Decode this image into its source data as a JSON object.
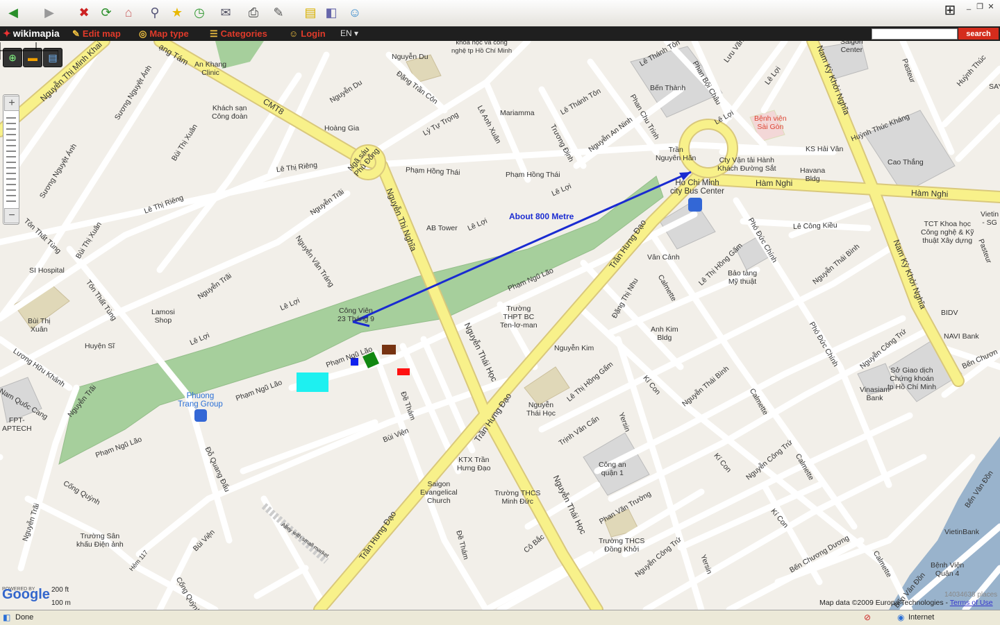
{
  "browser": {
    "toolbar_icons": [
      "back-icon",
      "forward-icon",
      "stop-icon",
      "refresh-icon",
      "home-icon",
      "search-icon",
      "favorites-icon",
      "history-icon",
      "mail-icon",
      "print-icon",
      "edit-icon",
      "discuss-icon",
      "research-icon",
      "messenger-icon"
    ],
    "status": "Done",
    "zone": "Internet"
  },
  "wikimapia": {
    "logo": "wikimapia",
    "menu": [
      "Edit map",
      "Map type",
      "Categories",
      "Login"
    ],
    "lang": "EN",
    "search_placeholder": "",
    "search_button": "search"
  },
  "map": {
    "annotation": "About 800 Metre",
    "scale_ft": "200 ft",
    "scale_m": "100 m",
    "google": "Google",
    "powered_by": "POWERED BY",
    "attribution": "Map data ©2009 Europa Technologies -",
    "terms": "Terms of Use",
    "places_count": "14034638 places",
    "places": {
      "an_khang": "An Khang\nClinic",
      "khach_san": "Khách sạn\nCông đoàn",
      "hoang_gia": "Hoàng Gia",
      "nguyen_du_place": "Nguyễn Du",
      "trung_tam": "Trung tâm thông tin\nkhoa học và công\nnghệ tp Hồ Chí Minh",
      "mariamma": "Mariamma",
      "ben_thanh": "Bến Thành",
      "tran_nguyen_han": "Trần\nNguyên Hãn",
      "benh_vien_sg": "Bệnh viện\nSài Gòn",
      "cty_van_tai": "Cty Vận tải Hành\nKhách Đường Sắt",
      "havana": "Havana\nBldg",
      "cao_thang": "Cao Thắng",
      "saigon_center": "Saigon\nCenter",
      "bus_center": "Ho Chi Minh\ncity Bus Center",
      "ab_tower": "AB Tower",
      "cong_vien": "Công Viên\n23 Tháng 9",
      "si_hospital": "SI Hospital",
      "bui_thi_xuan_place": "Bùi Thị\nXuân",
      "lamosi": "Lamosi\nShop",
      "huyen_si": "Huyện Sĩ",
      "phuong_trang": "Phuong\nTrang Group",
      "truong_thpt": "Trường\nTHPT BC\nTen-lơ-man",
      "van_canh": "Vân Cảnh",
      "bao_tang": "Bảo tàng\nMỹ thuật",
      "anh_kim": "Anh Kim\nBldg",
      "nguyen_kim": "Nguyễn Kim",
      "nguyen_thai_hoc_place": "Nguyễn\nThái Học",
      "cong_an": "Công an\nquận 1",
      "ktx": "KTX Trần\nHưng Đạo",
      "saigon_church": "Saigon\nEvangelical\nChurch",
      "thcs_minh_duc": "Trường THCS\nMinh Đức",
      "thcs_dong_khoi": "Trường THCS\nĐồng Khởi",
      "truong_san_khau": "Trường Sân\nkhấu Điện ảnh",
      "fpt": "FPT-\nAPTECH",
      "bidv": "BIDV",
      "navi": "NAVI Bank",
      "so_giao_dich": "Sở Giao dịch\nChứng khoán\ntp Hồ Chí Minh",
      "vinasiam": "Vinasiam\nBank",
      "vietinbank": "VietinBank",
      "benh_vien_q4": "Bệnh Viện\nQuận 4",
      "tct_khoa_hoc": "TCT Khoa học\nCông nghệ & Kỹ\nthuật Xây dựng",
      "vietin_sg": "Vietin\n- SG",
      "say": "SAY"
    },
    "streets": {
      "nguyen_thi_minh_khai": "Nguyễn Thị Minh Khai",
      "cmt8": "CMT8",
      "cach_mang_tam": "ạng Tám",
      "suong_nguyet_anh_1": "Sương Nguyệt Ánh",
      "suong_nguyet_anh_2": "Sương Nguyệt Ánh",
      "bui_thi_xuan_1": "Bùi Thị Xuân",
      "bui_thi_xuan_2": "Bùi Thị Xuân",
      "nguyen_du": "Nguyễn Du",
      "dang_tran_con": "Đặng Trần Côn",
      "ly_tu_trong": "Lý Tự Trọng",
      "le_anh_xuan": "Lê Anh Xuân",
      "le_thanh_ton_1": "Lê Thánh Tôn",
      "le_thanh_ton_2": "Lê Thánh Tôn",
      "truong_dinh": "Trương Định",
      "nguyen_an_ninh": "Nguyễn An Ninh",
      "phan_chu_trinh": "Phan Chu Trinh",
      "phan_boi_chau": "Phan Bội Châu",
      "luu_van_lang": "Lưu Văn Lang",
      "le_loi_1": "Lê Lợi",
      "le_loi_2": "Lê Lợi",
      "le_loi_3": "Lê Lợi",
      "le_loi_4": "Lê Lợi",
      "le_loi_5": "Lê Lợi",
      "le_loi_6": "Lê Lợi",
      "le_thi_rieng_1": "Lê Thị Riêng",
      "le_thi_rieng_2": "Lê Thị Riêng",
      "pham_hong_thai_1": "Phạm Hồng Thái",
      "pham_hong_thai_2": "Phạm Hồng Thái",
      "nga_sau": "Ngã sáu\nPhù Đổng",
      "nguyen_thi_nghia": "Nguyễn Thị Nghĩa",
      "nguyen_trai_1": "Nguyễn Trãi",
      "nguyen_trai_2": "Nguyễn Trãi",
      "nguyen_trai_3": "Nguyễn Trãi",
      "nguyen_trai_4": "Nguyễn Trãi",
      "nguyen_van_trang": "Nguyễn Văn Tráng",
      "ton_that_tung_1": "Tôn Thất Tùng",
      "ton_that_tung_2": "Tôn Thất Tùng",
      "luong_huu_khanh": "Lương Hữu Khánh",
      "nam_quoc_cang": "Nam Quốc Cang",
      "pham_ngu_lao_1": "Phạm Ngũ Lão",
      "pham_ngu_lao_2": "Phạm Ngũ Lão",
      "pham_ngu_lao_3": "Phạm Ngũ Lão",
      "pham_ngu_lao_4": "Phạm Ngũ Lão",
      "pham_ngu_lao_5": "Phạm Ngũ Lão",
      "nguyen_thai_hoc_1": "Nguyễn Thái Học",
      "nguyen_thai_hoc_2": "Nguyễn Thái Học",
      "tran_hung_dao_1": "Trần Hưng Đạo",
      "tran_hung_dao_2": "Trần Hưng Đạo",
      "tran_hung_dao_3": "Trần Hưng Đạo",
      "ham_nghi_1": "Hàm Nghi",
      "ham_nghi_2": "Hàm Nghi",
      "ks_hai_van": "KS Hải Vân",
      "huynh_thuc_khang": "Huỳnh Thúc Kháng",
      "huynh_thuc_khang_2": "Huỳnh Thúc",
      "nam_ky_1": "Nam Kỳ Khởi Nghĩa",
      "nam_ky_2": "Nam Kỳ Khởi Nghĩa",
      "pasteur_1": "Pasteur",
      "pasteur_2": "Pasteur",
      "pho_duc_chinh_1": "Phó Đức Chính",
      "pho_duc_chinh_2": "Phó Đức Chính",
      "le_cong_kieu": "Lê Công Kiều",
      "le_thi_hong_gam_1": "Lê Thị Hồng Gấm",
      "le_thi_hong_gam_2": "Lê Thị Hồng Gấm",
      "calmette_1": "Calmette",
      "calmette_2": "Calmette",
      "calmette_3": "Calmette",
      "calmette_4": "Calmette",
      "dang_thi_nhu": "Đặng Thị Nhu",
      "nguyen_thai_binh_1": "Nguyễn Thái Bình",
      "nguyen_thai_binh_2": "Nguyễn Thái Bình",
      "nguyen_cong_tru_1": "Nguyễn Công Trứ",
      "nguyen_cong_tru_2": "Nguyễn Công Trứ",
      "nguyen_cong_tru_3": "Nguyễn Công Trứ",
      "ki_con_1": "Kí Con",
      "ki_con_2": "Kí Con",
      "ki_con_3": "Kí Con",
      "yersin_1": "Yersin",
      "yersin_2": "Yersin",
      "trinh_van_can": "Trịnh Văn Cấn",
      "de_tham_1": "Đề Thám",
      "de_tham_2": "Đề Thám",
      "bui_vien_1": "Bùi Viện",
      "bui_vien_2": "Bùi Viện",
      "do_quang_dau": "Đỗ Quang Đẩu",
      "cong_quynh_1": "Cống Quỳnh",
      "cong_quynh_2": "Cống Quỳnh",
      "co_bac": "Cô Bắc",
      "phan_van_truong": "Phan Văn Trường",
      "ben_chuong_duong_1": "Bến Chương Dương",
      "ben_chuong_duong_2": "Bến Chươn",
      "ben_van_don_1": "Bến Vân Đồn",
      "ben_van_don_2": "Bến Vân Đồn",
      "alley": "Alley with small market",
      "hem_117": "Hẻm 117"
    }
  }
}
